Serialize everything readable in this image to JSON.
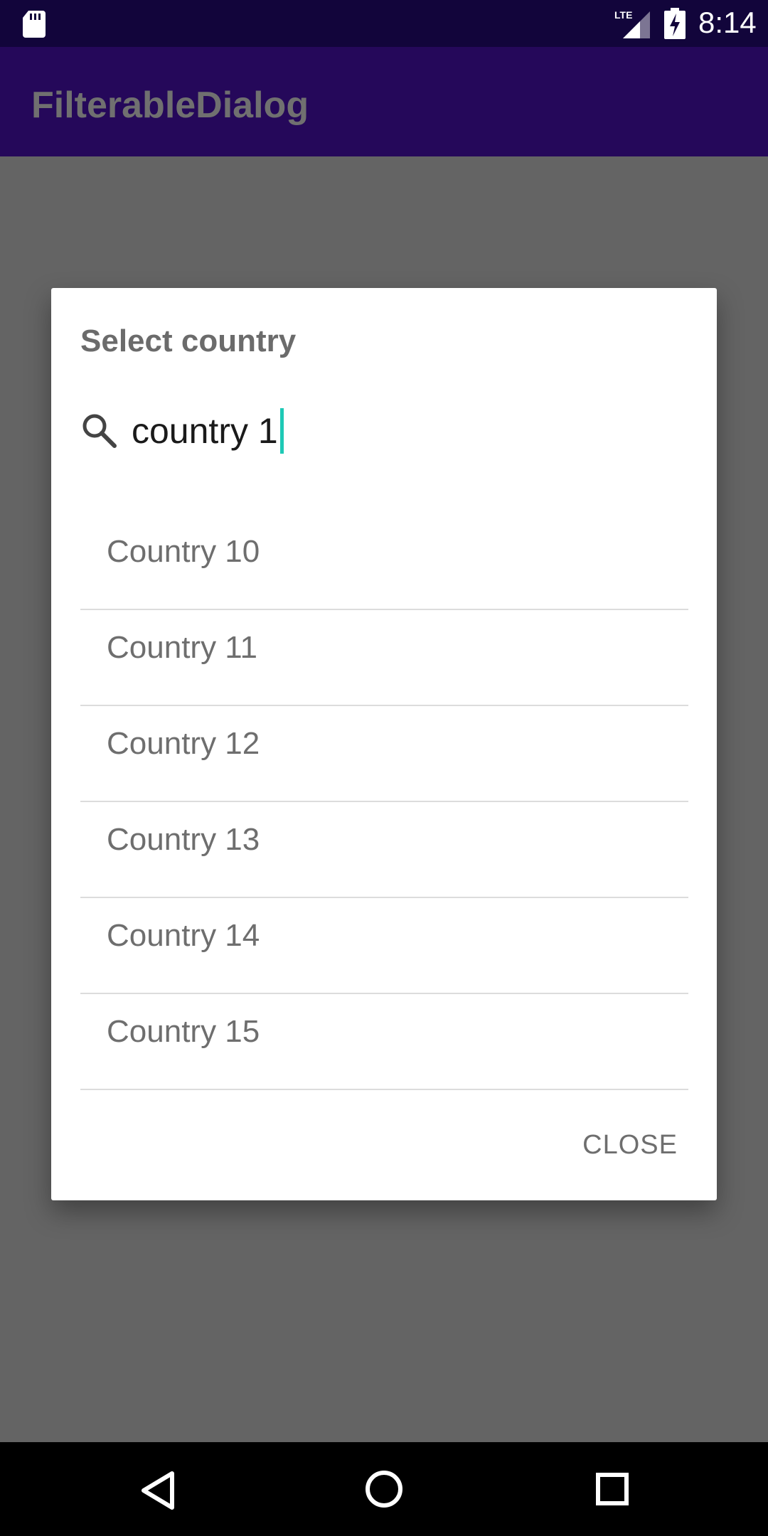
{
  "status_bar": {
    "time": "8:14",
    "network": "LTE",
    "icons": [
      "sd-card-icon",
      "lte-signal-icon",
      "battery-charging-icon"
    ]
  },
  "app_bar": {
    "title": "FilterableDialog"
  },
  "dialog": {
    "title": "Select country",
    "search": {
      "value": "country 1",
      "icon": "search-icon"
    },
    "items": [
      {
        "label": "Country 10"
      },
      {
        "label": "Country 11"
      },
      {
        "label": "Country 12"
      },
      {
        "label": "Country 13"
      },
      {
        "label": "Country 14"
      },
      {
        "label": "Country 15"
      }
    ],
    "close_label": "CLOSE"
  },
  "nav_bar": {
    "icons": [
      "back-icon",
      "home-icon",
      "recents-icon"
    ]
  },
  "colors": {
    "status_bar": "#12053b",
    "app_bar": "#25085a",
    "scrim": "#646464",
    "caret": "#1ec9b6"
  }
}
